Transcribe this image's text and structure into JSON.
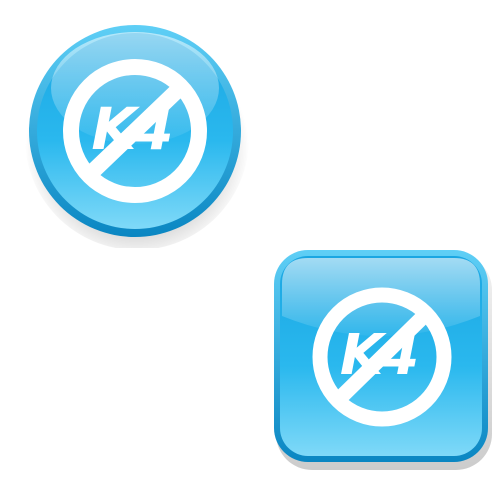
{
  "icons": [
    {
      "shape": "circle",
      "logo_text": "K4",
      "icon_name": "k4-logo-icon"
    },
    {
      "shape": "rounded-square",
      "logo_text": "K4",
      "icon_name": "k4-logo-icon"
    }
  ],
  "colors": {
    "background": "#ffffff",
    "accent_light": "#7fd8f8",
    "accent_mid": "#2cb8ec",
    "accent_dark": "#0d8fcb",
    "rim": "#0a7bb4",
    "logo": "#ffffff"
  }
}
